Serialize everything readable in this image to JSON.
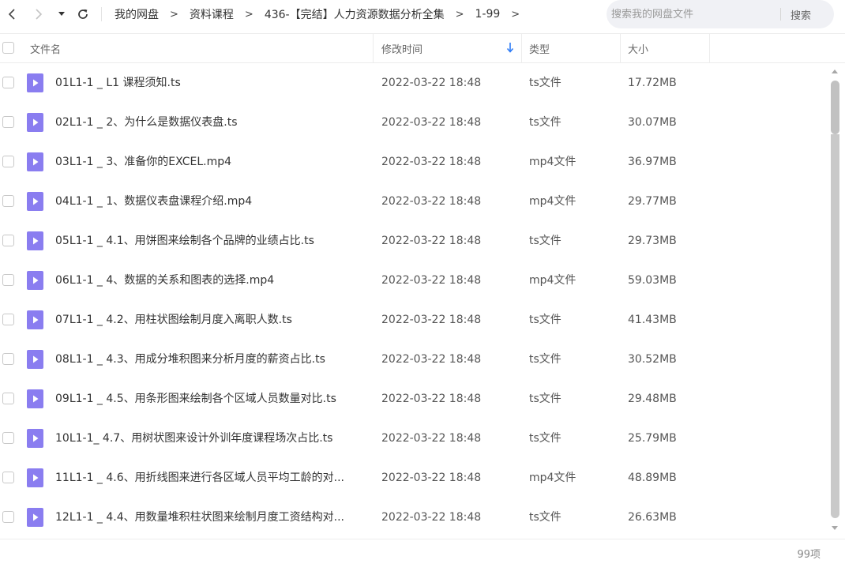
{
  "nav": {
    "back_icon": "chevron-left-icon",
    "forward_icon": "chevron-right-icon",
    "history_icon": "caret-down-icon",
    "refresh_icon": "refresh-icon"
  },
  "breadcrumb": [
    "我的网盘",
    "资料课程",
    "436-【完结】人力资源数据分析全集",
    "1-99"
  ],
  "breadcrumb_separator": ">",
  "search": {
    "placeholder": "搜索我的网盘文件",
    "button_label": "搜索"
  },
  "columns": {
    "name": "文件名",
    "mtime": "修改时间",
    "type": "类型",
    "size": "大小"
  },
  "sort_icon": "arrow-down-icon",
  "accent_color": "#2e7cf6",
  "file_icon_color": "#8a7df0",
  "files": [
    {
      "name": "01L1-1 _ L1 课程须知.ts",
      "mtime": "2022-03-22 18:48",
      "type": "ts文件",
      "size": "17.72MB"
    },
    {
      "name": "02L1-1 _ 2、为什么是数据仪表盘.ts",
      "mtime": "2022-03-22 18:48",
      "type": "ts文件",
      "size": "30.07MB"
    },
    {
      "name": "03L1-1 _ 3、准备你的EXCEL.mp4",
      "mtime": "2022-03-22 18:48",
      "type": "mp4文件",
      "size": "36.97MB"
    },
    {
      "name": "04L1-1 _ 1、数据仪表盘课程介绍.mp4",
      "mtime": "2022-03-22 18:48",
      "type": "mp4文件",
      "size": "29.77MB"
    },
    {
      "name": "05L1-1 _ 4.1、用饼图来绘制各个品牌的业绩占比.ts",
      "mtime": "2022-03-22 18:48",
      "type": "ts文件",
      "size": "29.73MB"
    },
    {
      "name": "06L1-1 _ 4、数据的关系和图表的选择.mp4",
      "mtime": "2022-03-22 18:48",
      "type": "mp4文件",
      "size": "59.03MB"
    },
    {
      "name": "07L1-1 _ 4.2、用柱状图绘制月度入离职人数.ts",
      "mtime": "2022-03-22 18:48",
      "type": "ts文件",
      "size": "41.43MB"
    },
    {
      "name": "08L1-1 _ 4.3、用成分堆积图来分析月度的薪资占比.ts",
      "mtime": "2022-03-22 18:48",
      "type": "ts文件",
      "size": "30.52MB"
    },
    {
      "name": "09L1-1 _ 4.5、用条形图来绘制各个区域人员数量对比.ts",
      "mtime": "2022-03-22 18:48",
      "type": "ts文件",
      "size": "29.48MB"
    },
    {
      "name": "10L1-1_ 4.7、用树状图来设计外训年度课程场次占比.ts",
      "mtime": "2022-03-22 18:48",
      "type": "ts文件",
      "size": "25.79MB"
    },
    {
      "name": "11L1-1 _ 4.6、用折线图来进行各区域人员平均工龄的对...",
      "mtime": "2022-03-22 18:48",
      "type": "mp4文件",
      "size": "48.89MB"
    },
    {
      "name": "12L1-1 _ 4.4、用数量堆积柱状图来绘制月度工资结构对...",
      "mtime": "2022-03-22 18:48",
      "type": "ts文件",
      "size": "26.63MB"
    }
  ],
  "footer": {
    "count": "99项"
  }
}
